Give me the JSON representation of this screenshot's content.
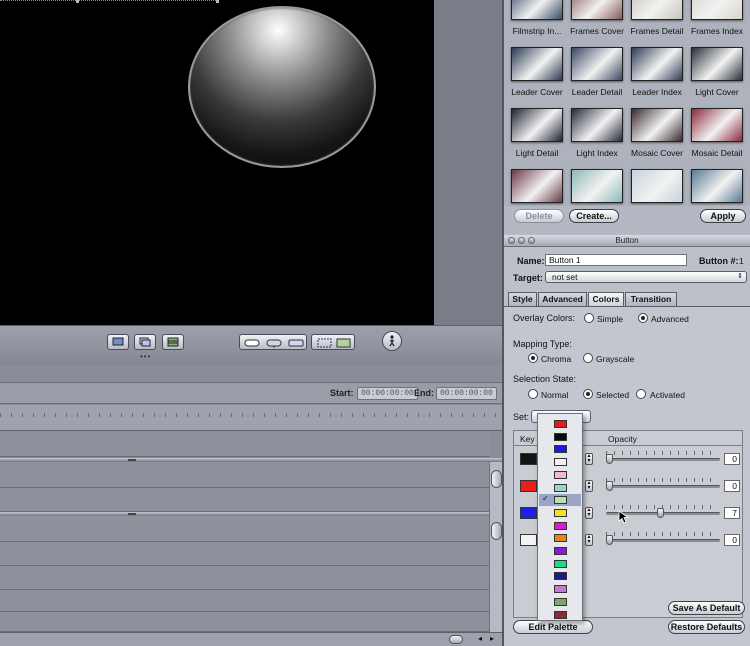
{
  "viewer": {
    "toolbar_icons": [
      "monitor-icon",
      "layers-icon",
      "film-icon",
      "button-shape-icon",
      "button-outline-icon",
      "button-arrows-icon",
      "safe-area-icon",
      "overlay-icon",
      "walker-icon"
    ]
  },
  "timeline": {
    "start_label": "Start:",
    "start_value": "00:00:00:00",
    "end_label": "End:",
    "end_value": "00:00:00:00"
  },
  "templates": {
    "rows": [
      [
        {
          "label": "Filmstrip In...",
          "color": "#3a4a63"
        },
        {
          "label": "Frames Cover",
          "color": "#8a5a5a"
        },
        {
          "label": "Frames Detail",
          "color": "#c9c4b8"
        },
        {
          "label": "Frames Index",
          "color": "#d8d4cc"
        }
      ],
      [
        {
          "label": "Leader Cover",
          "color": "#2c3a52"
        },
        {
          "label": "Leader Detail",
          "color": "#394860"
        },
        {
          "label": "Leader Index",
          "color": "#303c54"
        },
        {
          "label": "Light Cover",
          "color": "#2a2f3a"
        }
      ],
      [
        {
          "label": "Light Detail",
          "color": "#1f2432"
        },
        {
          "label": "Light Index",
          "color": "#262b38"
        },
        {
          "label": "Mosaic Cover",
          "color": "#3a2a30"
        },
        {
          "label": "Mosaic Detail",
          "color": "#8a2a3a"
        }
      ],
      [
        {
          "label": "",
          "color": "#6a3a48"
        },
        {
          "label": "",
          "color": "#8fb8b8"
        },
        {
          "label": "",
          "color": "#c4d4dc"
        },
        {
          "label": "",
          "color": "#5a7a94"
        }
      ]
    ],
    "delete_label": "Delete",
    "create_label": "Create...",
    "apply_label": "Apply"
  },
  "button_window": {
    "title": "Button",
    "name_label": "Name:",
    "name_value": "Button 1",
    "number_label": "Button #:",
    "number_value": "1",
    "target_label": "Target:",
    "target_value": "not set",
    "tabs": [
      "Style",
      "Advanced",
      "Colors",
      "Transition"
    ],
    "active_tab": "Colors",
    "overlay_label": "Overlay Colors:",
    "overlay_options": [
      "Simple",
      "Advanced"
    ],
    "overlay_selected": "Advanced",
    "mapping_label": "Mapping Type:",
    "mapping_options": [
      "Chroma",
      "Grayscale"
    ],
    "mapping_selected": "Chroma",
    "selection_label": "Selection State:",
    "selection_options": [
      "Normal",
      "Selected",
      "Activated"
    ],
    "selection_selected": "Selected",
    "set_label": "Set:",
    "key_header": "Key",
    "opacity_header": "Opacity",
    "keys": [
      {
        "color": "#101513",
        "opacity": "0"
      },
      {
        "color": "#ee1c1c",
        "opacity": "0"
      },
      {
        "color": "#1f1fe6",
        "opacity": "7"
      },
      {
        "color": "#f4f4f4",
        "opacity": "0"
      }
    ],
    "save_default_label": "Save As Default",
    "edit_palette_label": "Edit Palette",
    "restore_defaults_label": "Restore Defaults"
  },
  "palette": {
    "selected_index": 6,
    "check": "✓",
    "colors": [
      "#e21a1a",
      "#0a0a0a",
      "#1a1ae0",
      "#f2f2f2",
      "#f4b8cc",
      "#9ad6c8",
      "#b8e0b0",
      "#f2e41a",
      "#d81ad0",
      "#e8821a",
      "#8a1ad8",
      "#1ad890",
      "#1a1a8a",
      "#c07ad0",
      "#7aa86a",
      "#8a2a3a"
    ]
  }
}
